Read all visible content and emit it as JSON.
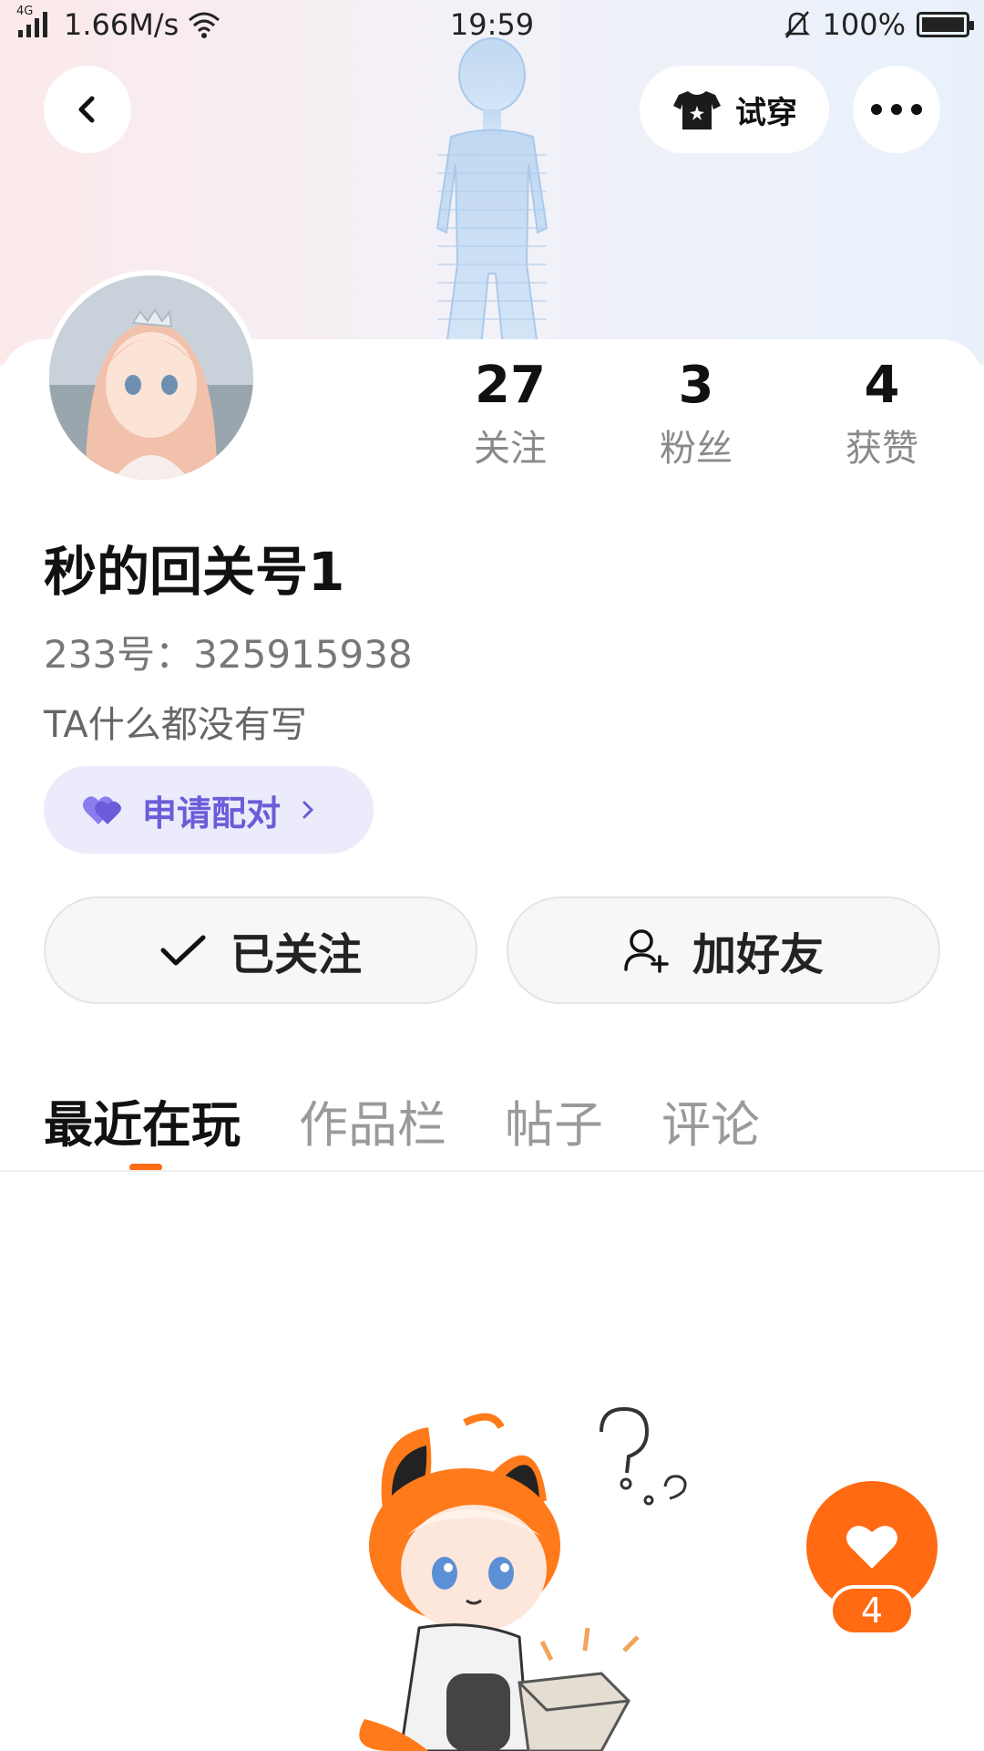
{
  "status_bar": {
    "network_type": "4G",
    "speed": "1.66M/s",
    "time": "19:59",
    "battery": "100%",
    "battery_level": 1.0
  },
  "top_nav": {
    "back_icon": "chevron-left-icon",
    "tryon_label": "试穿",
    "tryon_icon": "tshirt-icon",
    "more_icon": "more-dots-icon"
  },
  "profile": {
    "stats": [
      {
        "value": "27",
        "label": "关注"
      },
      {
        "value": "3",
        "label": "粉丝"
      },
      {
        "value": "4",
        "label": "获赞"
      }
    ],
    "nickname": "秒的回关号1",
    "uid": "233号：325915938",
    "bio": "TA什么都没有写",
    "pair_label": "申请配对"
  },
  "actions": {
    "followed_label": "已关注",
    "add_friend_label": "加好友"
  },
  "tabs": [
    {
      "label": "最近在玩",
      "active": true
    },
    {
      "label": "作品栏",
      "active": false
    },
    {
      "label": "帖子",
      "active": false
    },
    {
      "label": "评论",
      "active": false
    }
  ],
  "like_fab": {
    "count": "4"
  },
  "colors": {
    "accent": "#ff6a13",
    "pair_bg": "#ecebfb",
    "pair_text": "#6b5cd9"
  }
}
